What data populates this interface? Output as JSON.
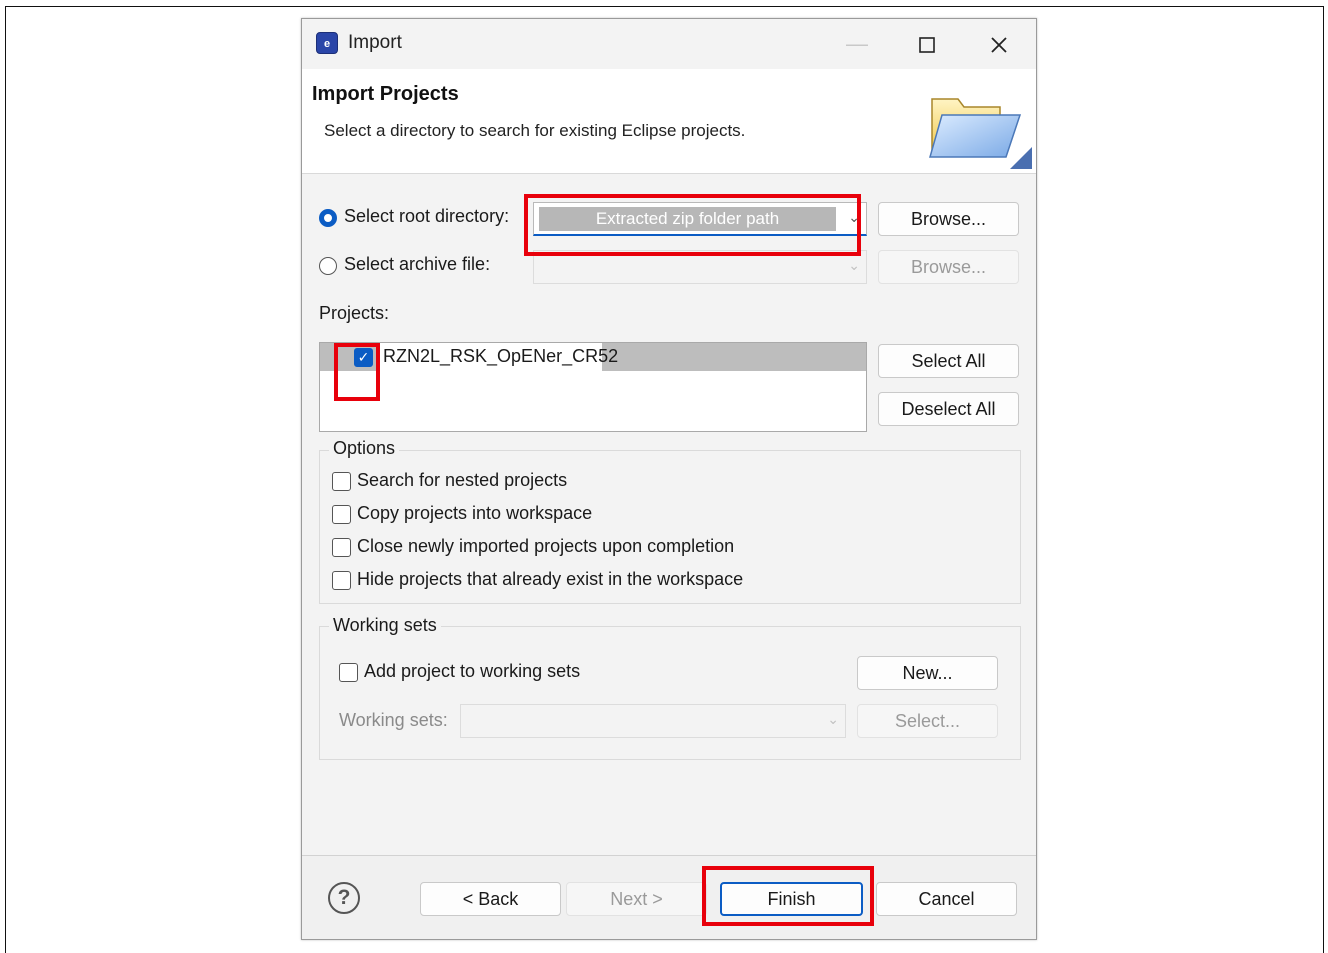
{
  "window": {
    "title": "Import",
    "icon": "eclipse-app-icon"
  },
  "header": {
    "title": "Import Projects",
    "subtitle": "Select a directory to search for existing Eclipse projects.",
    "icon": "folder-icon"
  },
  "source": {
    "root_radio_label": "Select root directory:",
    "root_selected": true,
    "root_value": "Extracted zip folder path",
    "archive_radio_label": "Select archive file:",
    "archive_value": "",
    "browse_label": "Browse...",
    "browse_archive_label": "Browse..."
  },
  "projects": {
    "label": "Projects:",
    "items": [
      {
        "name": "RZN2L_RSK_OpENer_CR52",
        "checked": true
      }
    ],
    "select_all_label": "Select All",
    "deselect_all_label": "Deselect All"
  },
  "options": {
    "label": "Options",
    "items": [
      {
        "label": "Search for nested projects",
        "checked": false
      },
      {
        "label": "Copy projects into workspace",
        "checked": false
      },
      {
        "label": "Close newly imported projects upon completion",
        "checked": false
      },
      {
        "label": "Hide projects that already exist in the workspace",
        "checked": false
      }
    ]
  },
  "working_sets": {
    "label": "Working sets",
    "add_label": "Add project to working sets",
    "add_checked": false,
    "new_label": "New...",
    "sets_label": "Working sets:",
    "select_label": "Select..."
  },
  "footer": {
    "help_label": "?",
    "back_label": "< Back",
    "next_label": "Next >",
    "finish_label": "Finish",
    "cancel_label": "Cancel"
  },
  "colors": {
    "accent": "#0b5cc4",
    "highlight_box": "#e8000b"
  }
}
